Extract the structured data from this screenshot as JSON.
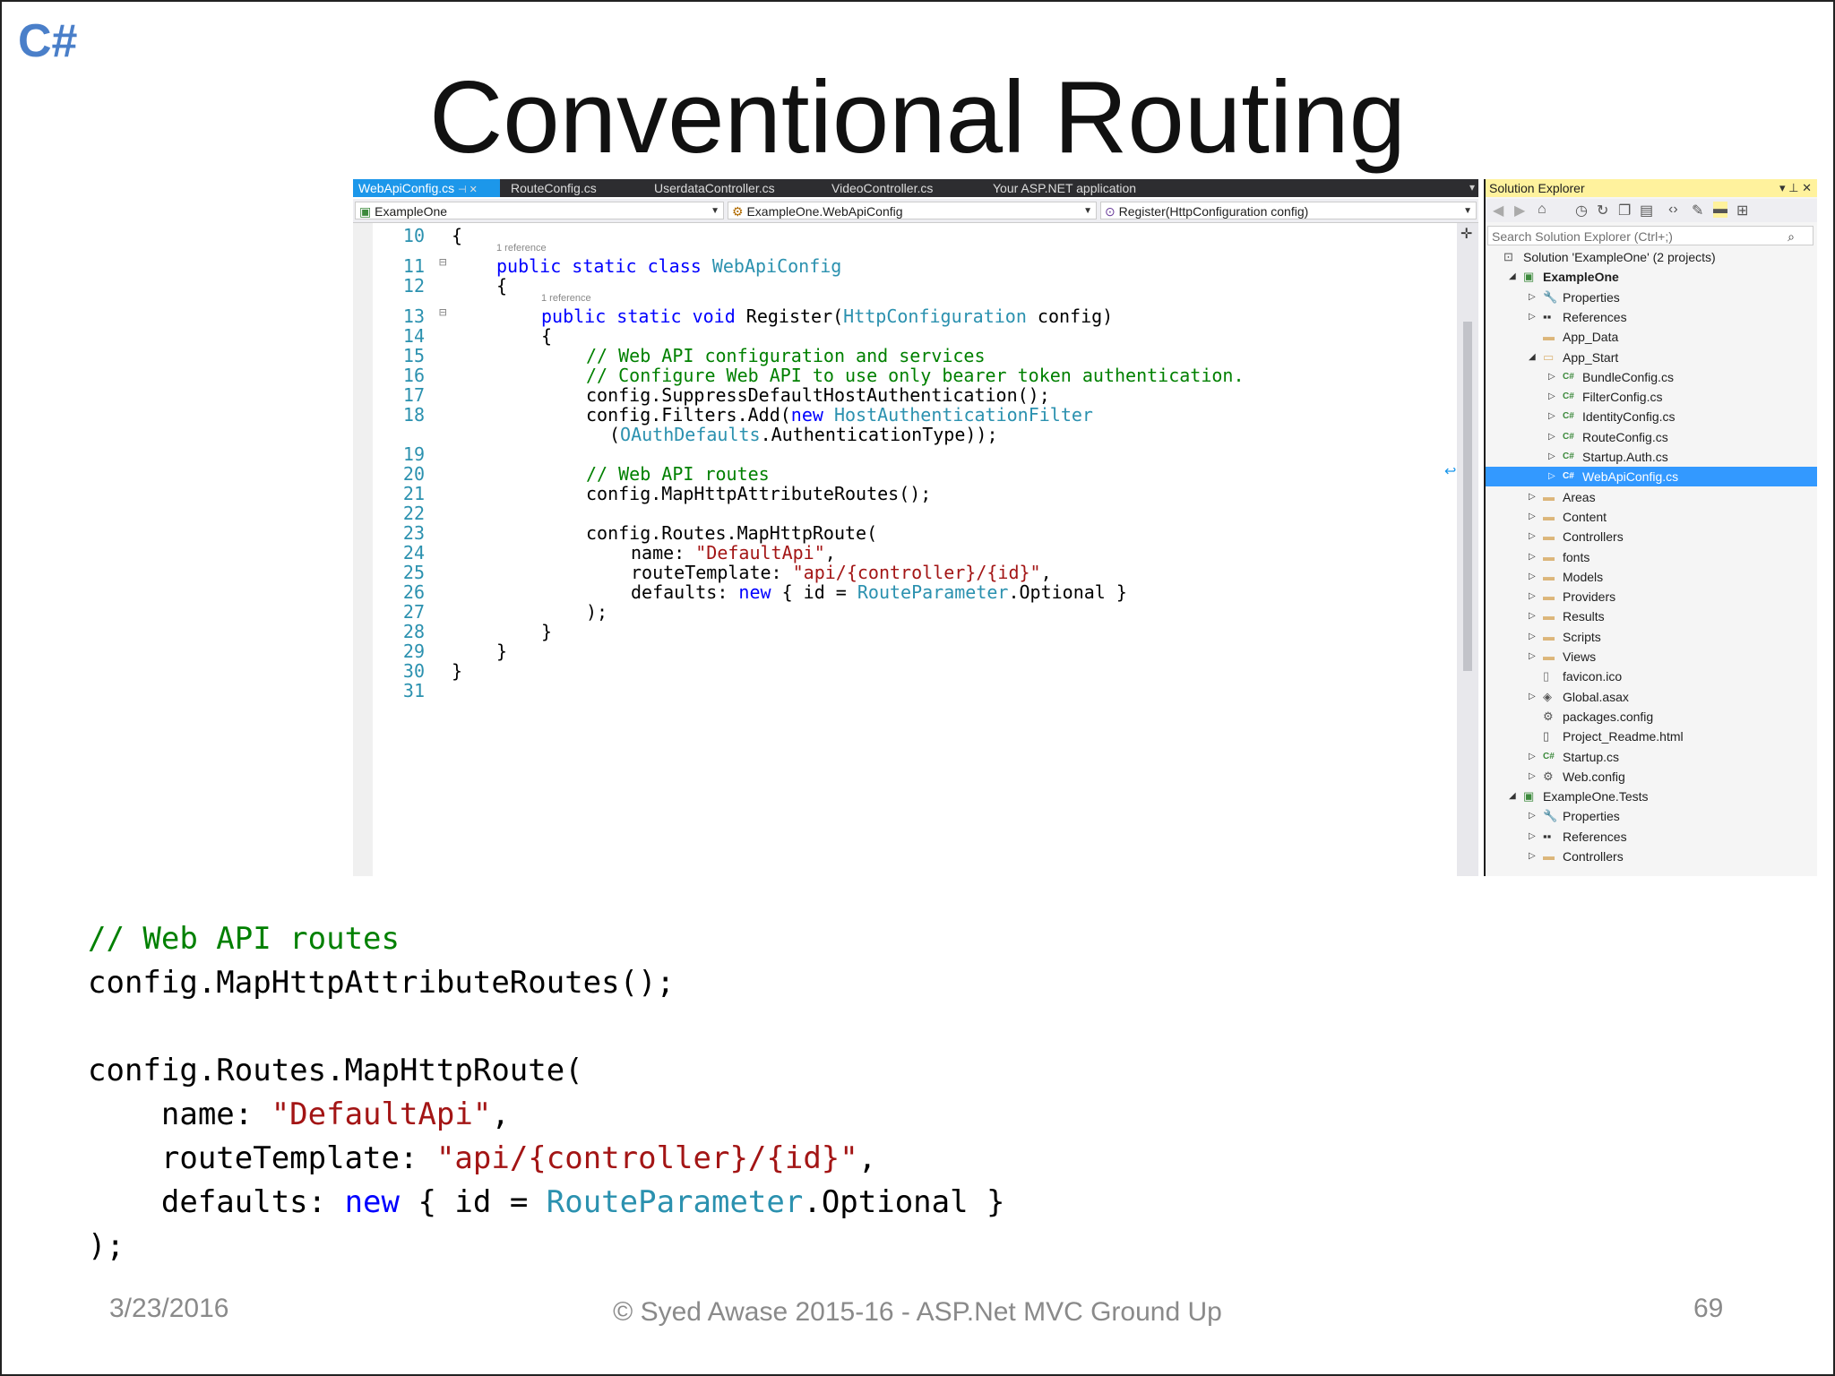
{
  "logo": "C#",
  "title": "Conventional Routing",
  "ide": {
    "tabs": [
      "WebApiConfig.cs",
      "RouteConfig.cs",
      "UserdataController.cs",
      "VideoController.cs",
      "Your ASP.NET application"
    ],
    "tab_pin": "⊣ ✕",
    "nav": {
      "project": "ExampleOne",
      "type": "ExampleOne.WebApiConfig",
      "member": "Register(HttpConfiguration config)"
    },
    "references_hint": "1 reference",
    "line_numbers": [
      "10",
      "11",
      "12",
      "13",
      "14",
      "15",
      "16",
      "17",
      "18",
      "19",
      "20",
      "21",
      "22",
      "23",
      "24",
      "25",
      "26",
      "27",
      "28",
      "29",
      "30",
      "31"
    ],
    "code": {
      "l10": "{",
      "l11_kw": "public static class ",
      "l11_ty": "WebApiConfig",
      "l12": "{",
      "l13_kw": "public static void ",
      "l13_name": "Register(",
      "l13_ty": "HttpConfiguration",
      "l13_end": " config)",
      "l14": "{",
      "l15": "// Web API configuration and services",
      "l16": "// Configure Web API to use only bearer token authentication.",
      "l17": "config.SuppressDefaultHostAuthentication();",
      "l18_a": "config.Filters.Add(",
      "l18_kw": "new ",
      "l18_ty": "HostAuthenticationFilter",
      "l18b_a": "(",
      "l18b_ty": "OAuthDefaults",
      "l18b_end": ".AuthenticationType));",
      "l20": "// Web API routes",
      "l21": "config.MapHttpAttributeRoutes();",
      "l23": "config.Routes.MapHttpRoute(",
      "l24_a": "name: ",
      "l24_st": "\"DefaultApi\"",
      "l24_end": ",",
      "l25_a": "routeTemplate: ",
      "l25_st": "\"api/{controller}/{id}\"",
      "l25_end": ",",
      "l26_a": "defaults: ",
      "l26_kw": "new",
      "l26_b": " { id = ",
      "l26_ty": "RouteParameter",
      "l26_end": ".Optional }",
      "l27": ");",
      "l28": "}",
      "l29": "}",
      "l30": "}"
    }
  },
  "solution_explorer": {
    "title": "Solution Explorer",
    "title_controls": "▾ ⊥ ✕",
    "search_placeholder": "Search Solution Explorer (Ctrl+;)",
    "items": [
      {
        "label": "Solution 'ExampleOne' (2 projects)",
        "indent": 0,
        "exp": "",
        "icon": "solution-icon"
      },
      {
        "label": "ExampleOne",
        "indent": 1,
        "exp": "◢",
        "icon": "project-icon",
        "bold": true
      },
      {
        "label": "Properties",
        "indent": 2,
        "exp": "▷",
        "icon": "wrench-icon"
      },
      {
        "label": "References",
        "indent": 2,
        "exp": "▷",
        "icon": "references-icon"
      },
      {
        "label": "App_Data",
        "indent": 2,
        "exp": "",
        "icon": "folder-icon"
      },
      {
        "label": "App_Start",
        "indent": 2,
        "exp": "◢",
        "icon": "folder-open-icon"
      },
      {
        "label": "BundleConfig.cs",
        "indent": 3,
        "exp": "▷",
        "icon": "csharp-file-icon"
      },
      {
        "label": "FilterConfig.cs",
        "indent": 3,
        "exp": "▷",
        "icon": "csharp-file-icon"
      },
      {
        "label": "IdentityConfig.cs",
        "indent": 3,
        "exp": "▷",
        "icon": "csharp-file-icon"
      },
      {
        "label": "RouteConfig.cs",
        "indent": 3,
        "exp": "▷",
        "icon": "csharp-file-icon"
      },
      {
        "label": "Startup.Auth.cs",
        "indent": 3,
        "exp": "▷",
        "icon": "csharp-file-icon"
      },
      {
        "label": "WebApiConfig.cs",
        "indent": 3,
        "exp": "▷",
        "icon": "csharp-file-icon",
        "selected": true
      },
      {
        "label": "Areas",
        "indent": 2,
        "exp": "▷",
        "icon": "folder-icon"
      },
      {
        "label": "Content",
        "indent": 2,
        "exp": "▷",
        "icon": "folder-icon"
      },
      {
        "label": "Controllers",
        "indent": 2,
        "exp": "▷",
        "icon": "folder-icon"
      },
      {
        "label": "fonts",
        "indent": 2,
        "exp": "▷",
        "icon": "folder-icon"
      },
      {
        "label": "Models",
        "indent": 2,
        "exp": "▷",
        "icon": "folder-icon"
      },
      {
        "label": "Providers",
        "indent": 2,
        "exp": "▷",
        "icon": "folder-icon"
      },
      {
        "label": "Results",
        "indent": 2,
        "exp": "▷",
        "icon": "folder-icon"
      },
      {
        "label": "Scripts",
        "indent": 2,
        "exp": "▷",
        "icon": "folder-icon"
      },
      {
        "label": "Views",
        "indent": 2,
        "exp": "▷",
        "icon": "folder-icon"
      },
      {
        "label": "favicon.ico",
        "indent": 2,
        "exp": "",
        "icon": "file-icon"
      },
      {
        "label": "Global.asax",
        "indent": 2,
        "exp": "▷",
        "icon": "asax-file-icon"
      },
      {
        "label": "packages.config",
        "indent": 2,
        "exp": "",
        "icon": "config-file-icon"
      },
      {
        "label": "Project_Readme.html",
        "indent": 2,
        "exp": "",
        "icon": "html-file-icon"
      },
      {
        "label": "Startup.cs",
        "indent": 2,
        "exp": "▷",
        "icon": "csharp-file-icon"
      },
      {
        "label": "Web.config",
        "indent": 2,
        "exp": "▷",
        "icon": "config-file-icon"
      },
      {
        "label": "ExampleOne.Tests",
        "indent": 1,
        "exp": "◢",
        "icon": "test-project-icon"
      },
      {
        "label": "Properties",
        "indent": 2,
        "exp": "▷",
        "icon": "wrench-icon"
      },
      {
        "label": "References",
        "indent": 2,
        "exp": "▷",
        "icon": "references-icon"
      },
      {
        "label": "Controllers",
        "indent": 2,
        "exp": "▷",
        "icon": "folder-icon"
      }
    ]
  },
  "snippet": {
    "comment": "// Web API routes",
    "line2": "config.MapHttpAttributeRoutes();",
    "line4": "config.Routes.MapHttpRoute(",
    "name_a": "    name: ",
    "name_st": "\"DefaultApi\"",
    "name_end": ",",
    "rt_a": "    routeTemplate: ",
    "rt_st": "\"api/{controller}/{id}\"",
    "rt_end": ",",
    "def_a": "    defaults: ",
    "def_kw": "new",
    "def_b": " { id = ",
    "def_ty": "RouteParameter",
    "def_end": ".Optional }",
    "close": ");"
  },
  "footer": {
    "date": "3/23/2016",
    "credit": "© Syed Awase 2015-16 - ASP.Net MVC Ground Up",
    "page": "69"
  },
  "colors": {
    "keyword": "#0000ff",
    "type": "#2b91af",
    "comment": "#008000",
    "string": "#a31515",
    "logo": "#4a7fc9",
    "selection": "#3399ff"
  }
}
